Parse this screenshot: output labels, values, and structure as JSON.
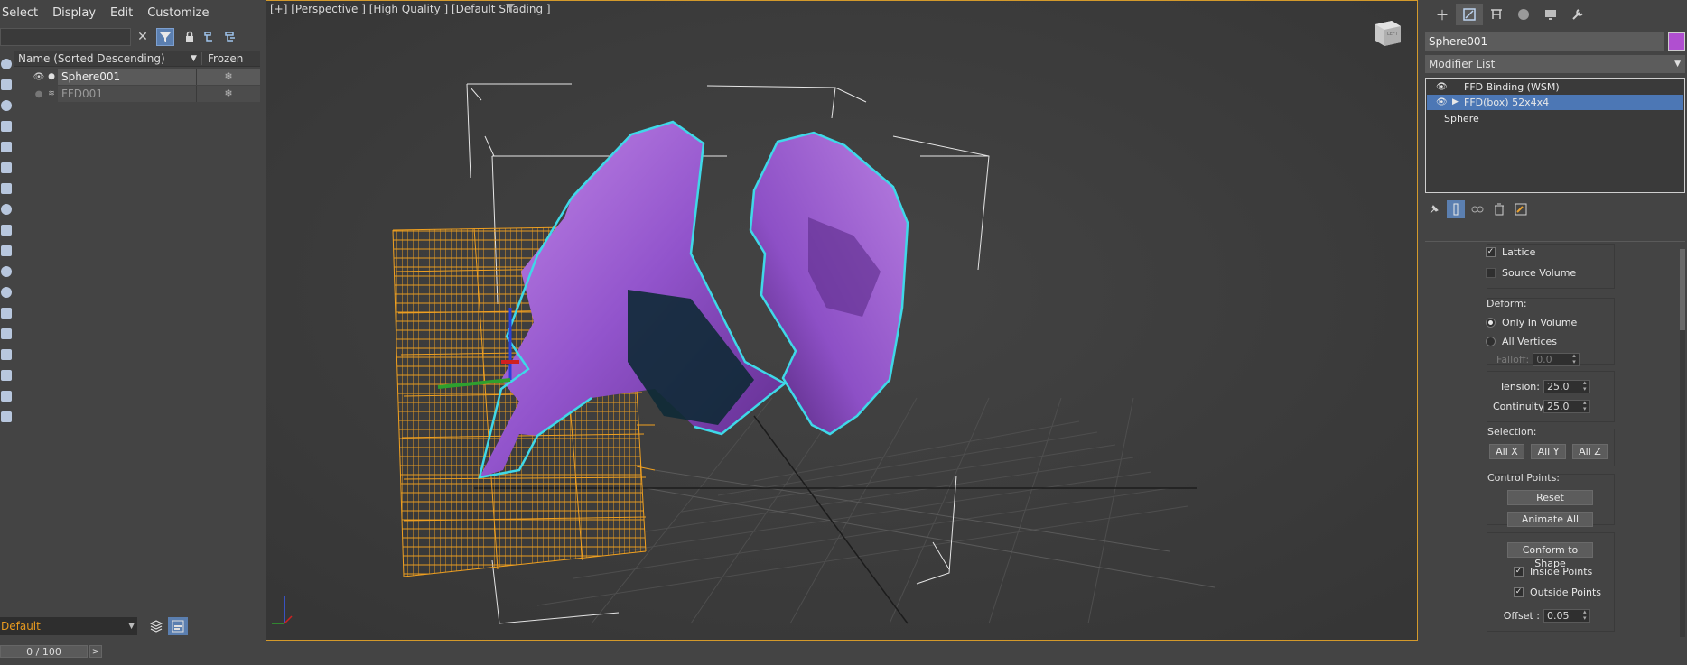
{
  "menu": [
    "Select",
    "Display",
    "Edit",
    "Customize"
  ],
  "explorer": {
    "columns": {
      "name": "Name (Sorted Descending)",
      "frozen": "Frozen"
    },
    "rows": [
      {
        "name": "Sphere001",
        "frozen_icon": "❄"
      },
      {
        "name": "FFD001",
        "frozen_icon": "❄"
      }
    ],
    "clear_icon": "✕"
  },
  "layer": {
    "current": "Default"
  },
  "timeline": {
    "position": "0 / 100",
    "next": ">"
  },
  "viewport": {
    "label": "[+] [Perspective ] [High Quality ] [Default Shading ]",
    "viewcube": "LEFT"
  },
  "command_panel": {
    "object_name": "Sphere001",
    "object_color": "#b04fd0",
    "modifier_list": "Modifier List",
    "stack": [
      {
        "label": "FFD Binding (WSM)",
        "selected": false
      },
      {
        "label": "FFD(box) 52x4x4",
        "selected": true
      },
      {
        "label": "Sphere",
        "selected": false
      }
    ],
    "params": {
      "lattice": "Lattice",
      "source_volume": "Source Volume",
      "deform_title": "Deform:",
      "only_in_volume": "Only In Volume",
      "all_vertices": "All Vertices",
      "falloff_label": "Falloff:",
      "falloff_value": "0.0",
      "tension_label": "Tension:",
      "tension_value": "25.0",
      "continuity_label": "Continuity:",
      "continuity_value": "25.0",
      "selection_title": "Selection:",
      "all_x": "All X",
      "all_y": "All Y",
      "all_z": "All Z",
      "control_points_title": "Control Points:",
      "reset": "Reset",
      "animate_all": "Animate All",
      "conform_to_shape": "Conform to Shape",
      "inside_points": "Inside Points",
      "outside_points": "Outside Points",
      "offset_label": "Offset :",
      "offset_value": "0.05"
    }
  },
  "colors": {
    "selection_outline": "#3fd8e8",
    "lattice": "#f0a020",
    "mesh": "#9a5cd0",
    "viewport_border": "#d49a2b"
  }
}
